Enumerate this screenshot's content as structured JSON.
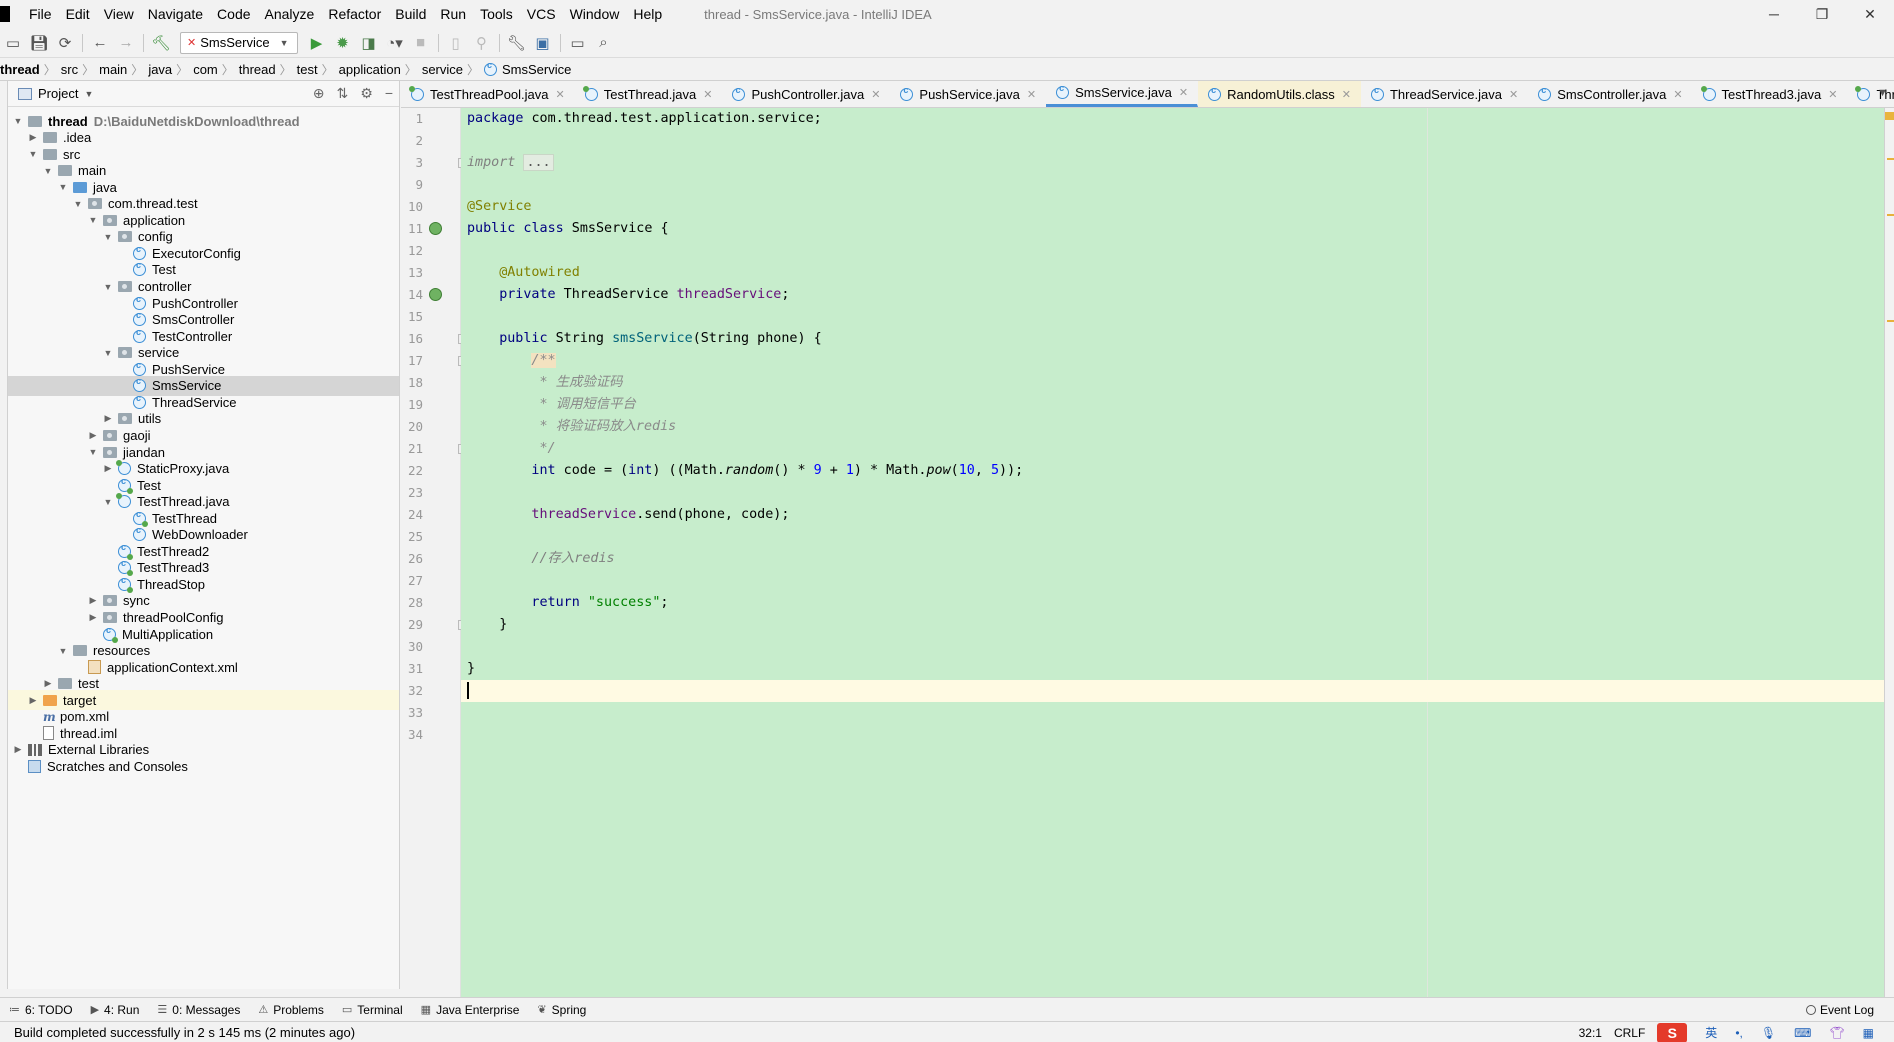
{
  "menu": {
    "items": [
      "File",
      "Edit",
      "View",
      "Navigate",
      "Code",
      "Analyze",
      "Refactor",
      "Build",
      "Run",
      "Tools",
      "VCS",
      "Window",
      "Help"
    ],
    "window_title": "thread - SmsService.java - IntelliJ IDEA",
    "window_controls": [
      "─",
      "❐",
      "✕"
    ]
  },
  "toolbar": {
    "run_config": "SmsService"
  },
  "breadcrumbs": [
    "thread",
    "src",
    "main",
    "java",
    "com",
    "thread",
    "test",
    "application",
    "service",
    "SmsService"
  ],
  "project_panel": {
    "title": "Project",
    "tree": [
      {
        "label": "thread",
        "extra": "D:\\BaiduNetdiskDownload\\thread",
        "depth": 0,
        "arrow": "down",
        "icon": "folder",
        "bold": true
      },
      {
        "label": ".idea",
        "depth": 1,
        "arrow": "right",
        "icon": "folder"
      },
      {
        "label": "src",
        "depth": 1,
        "arrow": "down",
        "icon": "folder"
      },
      {
        "label": "main",
        "depth": 2,
        "arrow": "down",
        "icon": "folder"
      },
      {
        "label": "java",
        "depth": 3,
        "arrow": "down",
        "icon": "src"
      },
      {
        "label": "com.thread.test",
        "depth": 4,
        "arrow": "down",
        "icon": "pkg"
      },
      {
        "label": "application",
        "depth": 5,
        "arrow": "down",
        "icon": "pkg"
      },
      {
        "label": "config",
        "depth": 6,
        "arrow": "down",
        "icon": "pkg"
      },
      {
        "label": "ExecutorConfig",
        "depth": 7,
        "arrow": "",
        "icon": "class"
      },
      {
        "label": "Test",
        "depth": 7,
        "arrow": "",
        "icon": "class"
      },
      {
        "label": "controller",
        "depth": 6,
        "arrow": "down",
        "icon": "pkg"
      },
      {
        "label": "PushController",
        "depth": 7,
        "arrow": "",
        "icon": "class"
      },
      {
        "label": "SmsController",
        "depth": 7,
        "arrow": "",
        "icon": "class"
      },
      {
        "label": "TestController",
        "depth": 7,
        "arrow": "",
        "icon": "class"
      },
      {
        "label": "service",
        "depth": 6,
        "arrow": "down",
        "icon": "pkg"
      },
      {
        "label": "PushService",
        "depth": 7,
        "arrow": "",
        "icon": "class"
      },
      {
        "label": "SmsService",
        "depth": 7,
        "arrow": "",
        "icon": "class",
        "selected": true
      },
      {
        "label": "ThreadService",
        "depth": 7,
        "arrow": "",
        "icon": "class"
      },
      {
        "label": "utils",
        "depth": 6,
        "arrow": "right",
        "icon": "pkg"
      },
      {
        "label": "gaoji",
        "depth": 5,
        "arrow": "right",
        "icon": "pkg"
      },
      {
        "label": "jiandan",
        "depth": 5,
        "arrow": "down",
        "icon": "pkg"
      },
      {
        "label": "StaticProxy.java",
        "depth": 6,
        "arrow": "right",
        "icon": "java"
      },
      {
        "label": "Test",
        "depth": 6,
        "arrow": "",
        "icon": "main"
      },
      {
        "label": "TestThread.java",
        "depth": 6,
        "arrow": "down",
        "icon": "java"
      },
      {
        "label": "TestThread",
        "depth": 7,
        "arrow": "",
        "icon": "main"
      },
      {
        "label": "WebDownloader",
        "depth": 7,
        "arrow": "",
        "icon": "class"
      },
      {
        "label": "TestThread2",
        "depth": 6,
        "arrow": "",
        "icon": "main"
      },
      {
        "label": "TestThread3",
        "depth": 6,
        "arrow": "",
        "icon": "main"
      },
      {
        "label": "ThreadStop",
        "depth": 6,
        "arrow": "",
        "icon": "main"
      },
      {
        "label": "sync",
        "depth": 5,
        "arrow": "right",
        "icon": "pkg"
      },
      {
        "label": "threadPoolConfig",
        "depth": 5,
        "arrow": "right",
        "icon": "pkg"
      },
      {
        "label": "MultiApplication",
        "depth": 5,
        "arrow": "",
        "icon": "main"
      },
      {
        "label": "resources",
        "depth": 3,
        "arrow": "down",
        "icon": "res"
      },
      {
        "label": "applicationContext.xml",
        "depth": 4,
        "arrow": "",
        "icon": "xml"
      },
      {
        "label": "test",
        "depth": 2,
        "arrow": "right",
        "icon": "folder"
      },
      {
        "label": "target",
        "depth": 1,
        "arrow": "right",
        "icon": "orange",
        "highlight": true
      },
      {
        "label": "pom.xml",
        "depth": 1,
        "arrow": "",
        "icon": "m"
      },
      {
        "label": "thread.iml",
        "depth": 1,
        "arrow": "",
        "icon": "file"
      },
      {
        "label": "External Libraries",
        "depth": 0,
        "arrow": "right",
        "icon": "lib"
      },
      {
        "label": "Scratches and Consoles",
        "depth": 0,
        "arrow": "",
        "icon": "scratch"
      }
    ]
  },
  "tabs": [
    {
      "label": "TestThreadPool.java",
      "active": false,
      "kind": "java"
    },
    {
      "label": "TestThread.java",
      "active": false,
      "kind": "java"
    },
    {
      "label": "PushController.java",
      "active": false,
      "kind": "class"
    },
    {
      "label": "PushService.java",
      "active": false,
      "kind": "class"
    },
    {
      "label": "SmsService.java",
      "active": true,
      "kind": "class"
    },
    {
      "label": "RandomUtils.class",
      "active": false,
      "kind": "compiled"
    },
    {
      "label": "ThreadService.java",
      "active": false,
      "kind": "class"
    },
    {
      "label": "SmsController.java",
      "active": false,
      "kind": "class"
    },
    {
      "label": "TestThread3.java",
      "active": false,
      "kind": "java"
    },
    {
      "label": "ThreadSto",
      "active": false,
      "kind": "java"
    }
  ],
  "editor": {
    "line_numbers": [
      "1",
      "2",
      "3",
      "9",
      "10",
      "11",
      "12",
      "13",
      "14",
      "15",
      "16",
      "17",
      "18",
      "19",
      "20",
      "21",
      "22",
      "23",
      "24",
      "25",
      "26",
      "27",
      "28",
      "29",
      "30",
      "31",
      "32",
      "33",
      "34"
    ],
    "cursor_line": "32",
    "code": {
      "l1_kw": "package",
      "l1_rest": " com.thread.test.application.service;",
      "l3_kw": "import",
      "l3_fold": "...",
      "l10": "@Service",
      "l11_kw": "public class",
      "l11_rest": " SmsService {",
      "l13": "@Autowired",
      "l14_kw": "private",
      "l14_mid": " ThreadService ",
      "l14_fld": "threadService",
      "l14_end": ";",
      "l16_kw": "public",
      "l16_a": " String ",
      "l16_m": "smsService",
      "l16_b": "(String phone) {",
      "l17": "/**",
      "l18": " * 生成验证码",
      "l19": " * 调用短信平台",
      "l20": " * 将验证码放入redis",
      "l21": " */",
      "l22_kw": "int",
      "l22_a": " code = (",
      "l22_kw2": "int",
      "l22_b": ") ((Math.",
      "l22_m": "random",
      "l22_c": "() * ",
      "l22_n1": "9",
      "l22_d": " + ",
      "l22_n2": "1",
      "l22_e": ") * Math.",
      "l22_m2": "pow",
      "l22_f": "(",
      "l22_n3": "10",
      "l22_g": ", ",
      "l22_n4": "5",
      "l22_h": "));",
      "l24_fld": "threadService",
      "l24_rest": ".send(phone, code);",
      "l26": "//存入redis",
      "l28_kw": "return",
      "l28_sp": " ",
      "l28_str": "\"success\"",
      "l28_end": ";",
      "l29": "}",
      "l31": "}"
    }
  },
  "bottom_tools": [
    {
      "icon": "≔",
      "label": "6: TODO"
    },
    {
      "icon": "▶",
      "label": "4: Run"
    },
    {
      "icon": "☰",
      "label": "0: Messages"
    },
    {
      "icon": "⚠",
      "label": "Problems"
    },
    {
      "icon": "▭",
      "label": "Terminal"
    },
    {
      "icon": "▦",
      "label": "Java Enterprise"
    },
    {
      "icon": "❦",
      "label": "Spring"
    }
  ],
  "event_log": "Event Log",
  "status": {
    "message": "Build completed successfully in 2 s 145 ms (2 minutes ago)",
    "position": "32:1",
    "line_sep": "CRLF",
    "ime_label": "英"
  },
  "colors": {
    "editor_bg": "#c7edcc",
    "current_line": "#fffae3",
    "keyword": "#000080",
    "annotation": "#808000",
    "string": "#008000",
    "number": "#0000ff",
    "field": "#660e7a",
    "active_tab_underline": "#4a8fd6"
  }
}
